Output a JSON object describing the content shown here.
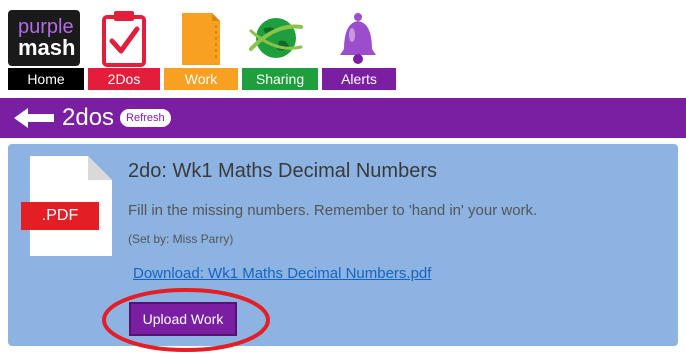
{
  "brand": {
    "line1": "purple",
    "line2": "mash"
  },
  "nav": {
    "tabs": [
      {
        "label": "Home",
        "color": "#000000"
      },
      {
        "label": "2Dos",
        "color": "#e31e3c"
      },
      {
        "label": "Work",
        "color": "#f7a021"
      },
      {
        "label": "Sharing",
        "color": "#1e9e3c"
      },
      {
        "label": "Alerts",
        "color": "#7b1fa2"
      }
    ],
    "icons": [
      "clipboard-check-icon",
      "folder-icon",
      "globe-icon",
      "bell-icon"
    ]
  },
  "header": {
    "title": "2dos",
    "refresh_label": "Refresh",
    "back_icon": "back-arrow-icon",
    "bar_color": "#7b1fa2"
  },
  "todo": {
    "file_type": ".PDF",
    "title": "2do: Wk1 Maths Decimal Numbers",
    "description": "Fill in the missing numbers. Remember to 'hand in' your work.",
    "set_by": "(Set by: Miss Parry)",
    "download_label": "Download: Wk1 Maths Decimal Numbers.pdf",
    "upload_label": "Upload Work",
    "card_color": "#8db3e2",
    "highlight_color": "#e31e24"
  }
}
